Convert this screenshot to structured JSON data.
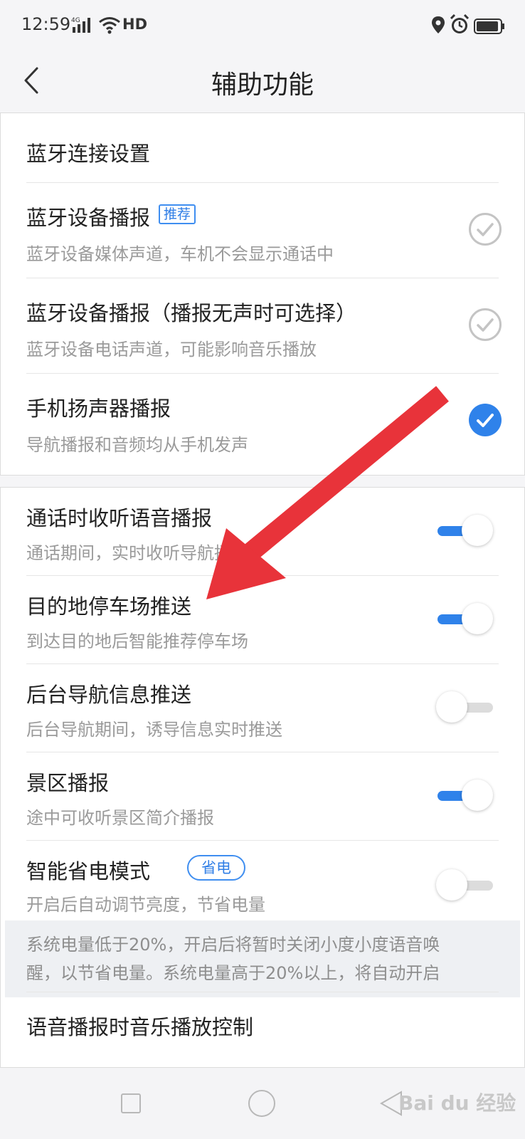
{
  "status_bar": {
    "time": "12:59",
    "network": "4G",
    "wifi_label": "HD",
    "icons": [
      "signal-icon",
      "wifi-icon",
      "location-icon",
      "alarm-icon",
      "battery-icon"
    ]
  },
  "header": {
    "title": "辅助功能",
    "back_icon": "chevron-left-icon"
  },
  "section1": {
    "heading": "蓝牙连接设置",
    "options": [
      {
        "title": "蓝牙设备播报",
        "badge": "推荐",
        "subtitle": "蓝牙设备媒体声道，车机不会显示通话中",
        "selected": false
      },
      {
        "title": "蓝牙设备播报（播报无声时可选择）",
        "subtitle": "蓝牙设备电话声道，可能影响音乐播放",
        "selected": false
      },
      {
        "title": "手机扬声器播报",
        "subtitle": "导航播报和音频均从手机发声",
        "selected": true
      }
    ]
  },
  "section2": {
    "toggles": [
      {
        "title": "通话时收听语音播报",
        "subtitle": "通话期间，实时收听导航播报",
        "on": true
      },
      {
        "title": "目的地停车场推送",
        "subtitle": "到达目的地后智能推荐停车场",
        "on": true
      },
      {
        "title": "后台导航信息推送",
        "subtitle": "后台导航期间，诱导信息实时推送",
        "on": false
      },
      {
        "title": "景区播报",
        "subtitle": "途中可收听景区简介播报",
        "on": true
      },
      {
        "title": "智能省电模式",
        "badge": "省电",
        "subtitle": "开启后自动调节亮度，节省电量",
        "on": false
      }
    ],
    "note_line1": "系统电量低于20%，开启后将暂时关闭小度小度语音唤",
    "note_line2": "醒，以节省电量。系统电量高于20%以上，将自动开启",
    "last_item": "语音播报时音乐播放控制"
  },
  "colors": {
    "accent": "#2f82ea",
    "annotation_arrow": "#e8333a"
  },
  "watermark": "Bai du 经验"
}
